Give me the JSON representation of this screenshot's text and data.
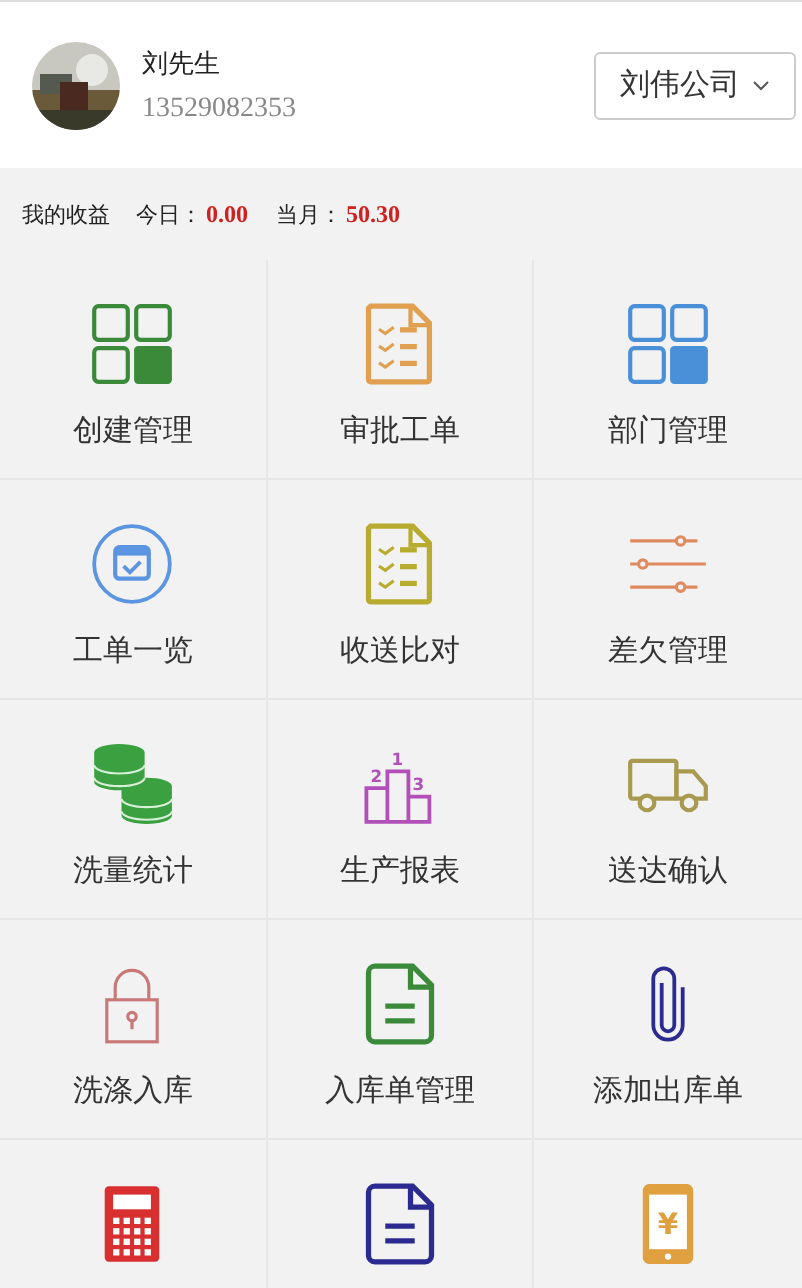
{
  "user": {
    "name": "刘先生",
    "phone": "13529082353"
  },
  "company_button": {
    "label": "刘伟公司"
  },
  "earnings": {
    "title": "我的收益",
    "today_label": "今日：",
    "today_value": "0.00",
    "month_label": "当月：",
    "month_value": "50.30"
  },
  "tile_rows": [
    [
      {
        "label": "创建管理",
        "kind": "grid",
        "color": "#3a8a3a"
      },
      {
        "label": "审批工单",
        "kind": "checklist",
        "color": "#e0a050"
      },
      {
        "label": "部门管理",
        "kind": "grid",
        "color": "#4a90d9"
      }
    ],
    [
      {
        "label": "工单一览",
        "kind": "calendar",
        "color": "#5b94e0"
      },
      {
        "label": "收送比对",
        "kind": "checklist",
        "color": "#b8ac30"
      },
      {
        "label": "差欠管理",
        "kind": "sliders",
        "color": "#e08a60"
      }
    ],
    [
      {
        "label": "洗量统计",
        "kind": "coins",
        "color": "#3aa040"
      },
      {
        "label": "生产报表",
        "kind": "podium",
        "color": "#b050b8",
        "marks": [
          "2",
          "1",
          "3"
        ]
      },
      {
        "label": "送达确认",
        "kind": "truck",
        "color": "#a89a50"
      }
    ],
    [
      {
        "label": "洗涤入库",
        "kind": "lock",
        "color": "#c87878"
      },
      {
        "label": "入库单管理",
        "kind": "document",
        "color": "#3a8a3a"
      },
      {
        "label": "添加出库单",
        "kind": "paperclip",
        "color": "#2a2a90"
      }
    ],
    [
      {
        "kind": "calculator",
        "color": "#d83030"
      },
      {
        "kind": "document",
        "color": "#2a2a90"
      },
      {
        "kind": "phone-yen",
        "color": "#e0a040",
        "mark": "¥"
      }
    ]
  ]
}
